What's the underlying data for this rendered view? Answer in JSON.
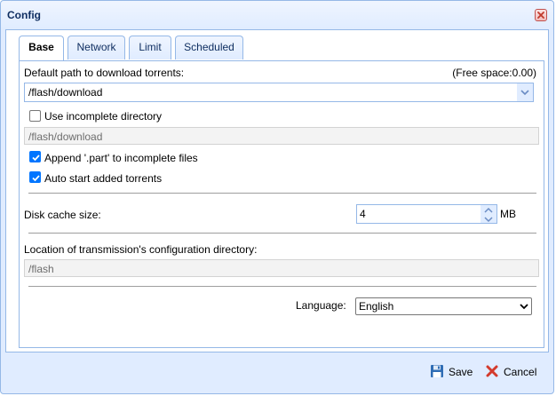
{
  "window": {
    "title": "Config"
  },
  "tabs": [
    {
      "label": "Base",
      "active": true
    },
    {
      "label": "Network",
      "active": false
    },
    {
      "label": "Limit",
      "active": false
    },
    {
      "label": "Scheduled",
      "active": false
    }
  ],
  "base": {
    "download_path_label": "Default path to download torrents:",
    "free_space": "(Free space:0.00)",
    "download_path_value": "/flash/download",
    "use_incomplete_label": "Use incomplete directory",
    "use_incomplete_checked": false,
    "incomplete_path_value": "/flash/download",
    "append_part_label": "Append '.part' to incomplete files",
    "append_part_checked": true,
    "auto_start_label": "Auto start added torrents",
    "auto_start_checked": true,
    "disk_cache_label": "Disk cache size:",
    "disk_cache_value": "4",
    "disk_cache_unit": "MB",
    "config_dir_label": "Location of transmission's configuration directory:",
    "config_dir_value": "/flash",
    "language_label": "Language:",
    "language_value": "English"
  },
  "footer": {
    "save_label": "Save",
    "cancel_label": "Cancel"
  },
  "colors": {
    "border": "#95b8e7",
    "header_bg": "#e0ecff",
    "check_blue": "#0075ff",
    "cancel_red": "#d33a2c"
  },
  "icons": [
    "close-icon",
    "dropdown-arrow-icon",
    "spinner-up-icon",
    "spinner-down-icon",
    "save-icon",
    "cancel-icon",
    "checkmark-icon"
  ]
}
